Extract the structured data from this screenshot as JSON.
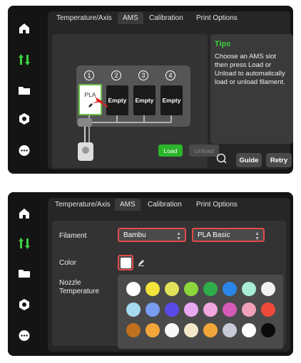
{
  "colors": {
    "accent_green": "#3ecf3e",
    "highlight_red": "#e04b4b",
    "load_green": "#2bb52b"
  },
  "screen1": {
    "sidebar": {
      "icons": [
        "home-icon",
        "sliders-icon",
        "folder-icon",
        "settings-icon",
        "chat-icon"
      ]
    },
    "tabs": [
      "Temperature/Axis",
      "AMS",
      "Calibration",
      "Print Options"
    ],
    "active_tab": "AMS",
    "slots": [
      {
        "number": "1",
        "label": "PLA"
      },
      {
        "number": "2",
        "label": "Empty"
      },
      {
        "number": "3",
        "label": "Empty"
      },
      {
        "number": "4",
        "label": "Empty"
      }
    ],
    "load_label": "Load",
    "unload_label": "Unload",
    "tips": {
      "title": "Tips",
      "body": "Choose an AMS slot then press Load or Unload to automatically load or unload filament."
    },
    "guide_label": "Guide",
    "retry_label": "Retry"
  },
  "screen2": {
    "tabs": [
      "Temperature/Axis",
      "AMS",
      "Calibration",
      "Print Options"
    ],
    "active_tab": "AMS",
    "filament_label": "Filament",
    "filament_brand": "Bambu",
    "filament_type": "PLA Basic",
    "color_label": "Color",
    "nozzle_label_1": "Nozzle",
    "nozzle_label_2": "Temperature",
    "palette": [
      [
        "#ffffff",
        "#f2e33a",
        "#e0e25a",
        "#8bd63a",
        "#2eae4a",
        "#2a85e8",
        "#a8ecd8",
        "#f2f2f2"
      ],
      [
        "#a6daf0",
        "#7a9cf0",
        "#5a4ae8",
        "#e8a8f0",
        "#f2a6e0",
        "#d85ab8",
        "#f0a0b8",
        "#ee4a3a"
      ],
      [
        "#c0701e",
        "#f2a63a",
        "#f8f8f8",
        "#f4e8c8",
        "#f2a63a",
        "#c8cad8",
        "#ffffff",
        "#0a0a0a"
      ]
    ]
  }
}
